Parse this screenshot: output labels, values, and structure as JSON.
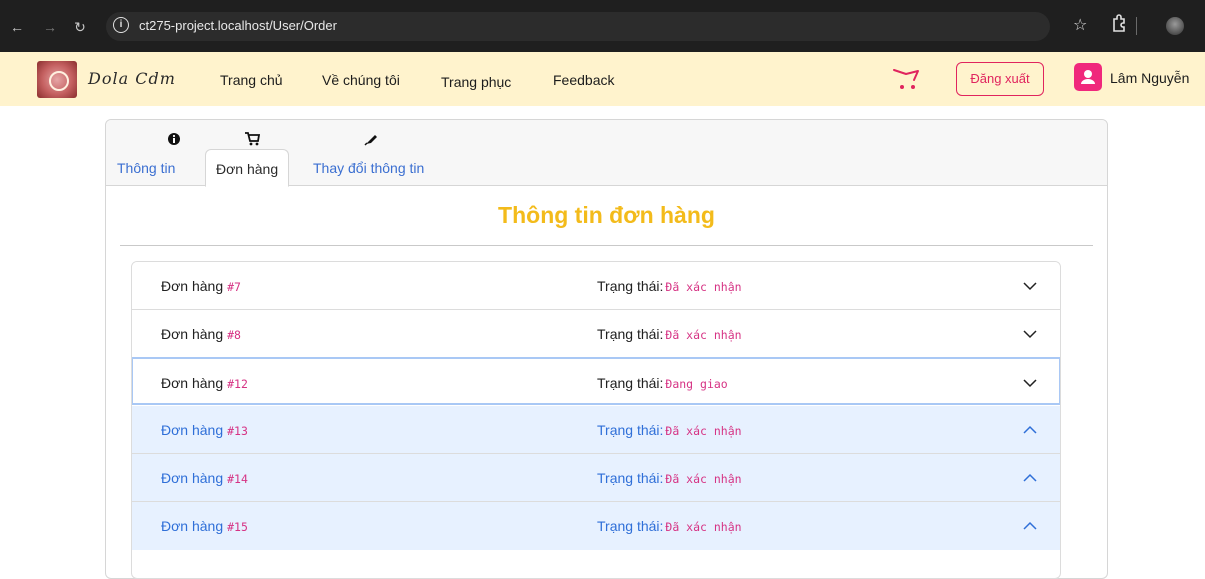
{
  "browser": {
    "url": "ct275-project.localhost/User/Order",
    "back_icon": "arrow-left-icon",
    "forward_icon": "arrow-right-icon",
    "reload_icon": "reload-icon",
    "star_icon": "star-icon",
    "extensions_icon": "puzzle-icon",
    "profile_icon": "profile-avatar-icon"
  },
  "navbar": {
    "bg_color": "#fff3cd",
    "brand_script": "Dola Cdm",
    "links": [
      "Trang chủ",
      "Về chúng tôi",
      "Trang phục",
      "Feedback"
    ],
    "logout_label": "Đăng xuất",
    "user_name": "Lâm Nguyễn",
    "accent_color": "#e0245e"
  },
  "tabs": [
    {
      "label": "Thông tin",
      "icon": "info-circle-icon",
      "active": false
    },
    {
      "label": "Đơn hàng",
      "icon": "cart-icon",
      "active": true
    },
    {
      "label": "Thay đổi thông tin",
      "icon": "pen-icon",
      "active": false
    }
  ],
  "section_title": "Thông tin đơn hàng",
  "title_color": "#f3bb1b",
  "orders": [
    {
      "label": "Đơn hàng",
      "id": "#7",
      "status_label": "Trạng thái:",
      "status": "Đã xác nhận",
      "expanded": false
    },
    {
      "label": "Đơn hàng",
      "id": "#8",
      "status_label": "Trạng thái:",
      "status": "Đã xác nhận",
      "expanded": false
    },
    {
      "label": "Đơn hàng",
      "id": "#12",
      "status_label": "Trạng thái:",
      "status": "Đang giao",
      "expanded": false,
      "focused": true
    },
    {
      "label": "Đơn hàng",
      "id": "#13",
      "status_label": "Trạng thái:",
      "status": "Đã xác nhận",
      "expanded": true
    },
    {
      "label": "Đơn hàng",
      "id": "#14",
      "status_label": "Trạng thái:",
      "status": "Đã xác nhận",
      "expanded": true
    },
    {
      "label": "Đơn hàng",
      "id": "#15",
      "status_label": "Trạng thái:",
      "status": "Đã xác nhận",
      "expanded": true
    }
  ]
}
